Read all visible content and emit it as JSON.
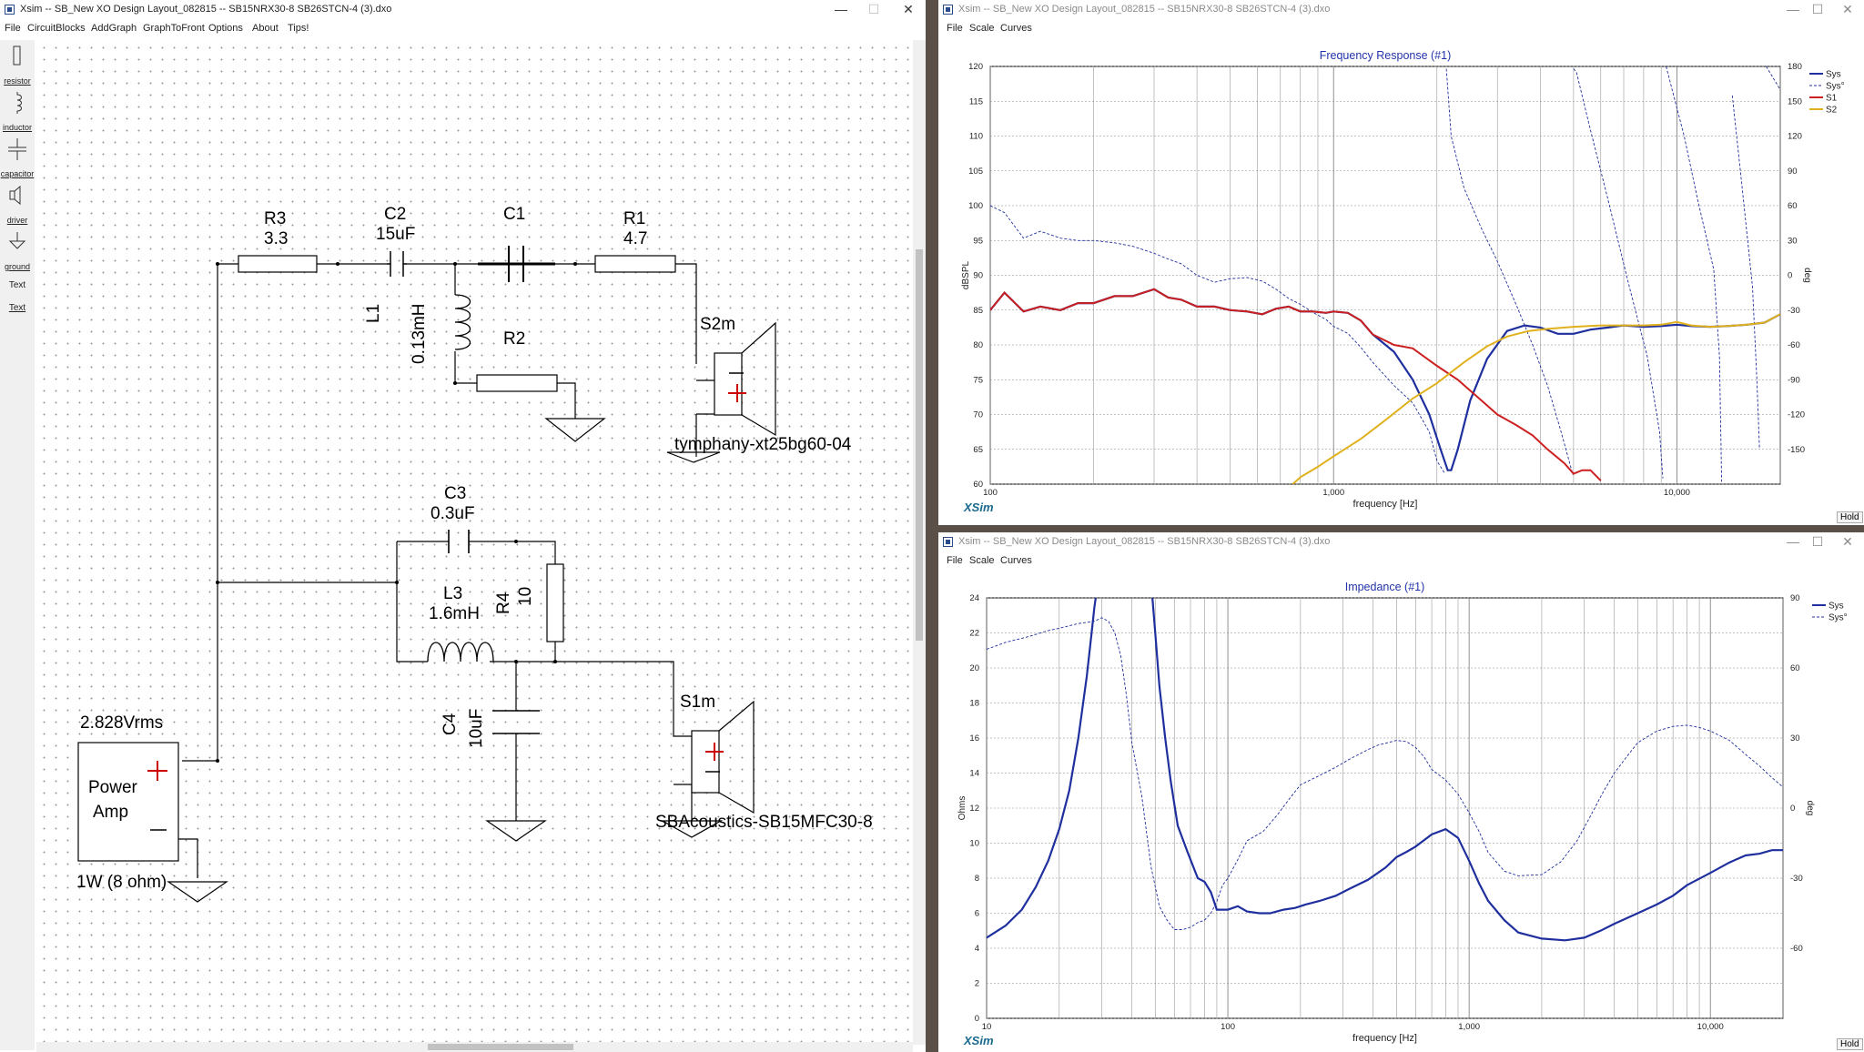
{
  "schematic_window": {
    "title": "Xsim -- SB_New XO Design Layout_082815 -- SB15NRX30-8 SB26STCN-4 (3).dxo",
    "controls": {
      "minimize": "—",
      "maximize": "☐",
      "close": "✕"
    },
    "menu": [
      "File",
      "CircuitBlocks",
      "AddGraph",
      "GraphToFront",
      "Options",
      "About",
      "Tips!"
    ],
    "tools": [
      {
        "label": "resistor",
        "icon": "resistor-icon"
      },
      {
        "label": "inductor",
        "icon": "inductor-icon"
      },
      {
        "label": "capacitor",
        "icon": "capacitor-icon"
      },
      {
        "label": "driver",
        "icon": "driver-icon"
      },
      {
        "label": "ground",
        "icon": "ground-icon"
      },
      {
        "label": "Text",
        "icon": ""
      },
      {
        "label": "Text",
        "icon": ""
      }
    ],
    "components": {
      "R3": {
        "name": "R3",
        "value": "3.3"
      },
      "C2": {
        "name": "C2",
        "value": "15uF"
      },
      "C1": {
        "name": "C1"
      },
      "R1": {
        "name": "R1",
        "value": "4.7"
      },
      "L1": {
        "name": "L1",
        "value": "0.13mH"
      },
      "R2": {
        "name": "R2"
      },
      "S2m": {
        "name": "S2m",
        "model": "tymphany-xt25bg60-04"
      },
      "C3": {
        "name": "C3",
        "value": "0.3uF"
      },
      "L3": {
        "name": "L3",
        "value": "1.6mH"
      },
      "R4": {
        "name": "R4",
        "value": "10"
      },
      "C4": {
        "name": "C4",
        "value": "10uF"
      },
      "S1m": {
        "name": "S1m",
        "model": "SBAcoustics-SB15MFC30-8"
      },
      "amp": {
        "voltage": "2.828Vrms",
        "label1": "Power",
        "label2": "Amp",
        "power": "1W (8 ohm)"
      }
    }
  },
  "fr_window": {
    "title": "Xsim -- SB_New XO Design Layout_082815 -- SB15NRX30-8 SB26STCN-4 (3).dxo",
    "menu": [
      "File",
      "Scale",
      "Curves"
    ],
    "logo": "XSim",
    "hold": "Hold",
    "colors": {
      "sys": "#1f2f9e",
      "s1": "#cc1f1f",
      "s2": "#e0b11c"
    },
    "chart_data": {
      "type": "line",
      "title": "Frequency Response (#1)",
      "xlabel": "frequency [Hz]",
      "ylabel": "dBSPL",
      "y2label": "deg",
      "xscale": "log",
      "xlim": [
        100,
        20000
      ],
      "ylim": [
        60,
        120
      ],
      "y2lim": [
        -180,
        180
      ],
      "x_tick_labels": [
        "100",
        "1,000",
        "10,000"
      ],
      "y_ticks": [
        60,
        65,
        70,
        75,
        80,
        85,
        90,
        95,
        100,
        105,
        110,
        115,
        120
      ],
      "y2_ticks": [
        -150,
        -120,
        -90,
        -60,
        -30,
        0,
        30,
        60,
        90,
        120,
        150,
        180
      ],
      "legend": [
        "Sys",
        "Sys°",
        "S1",
        "S2"
      ],
      "legend_position": "top-right",
      "series": [
        {
          "name": "Sys",
          "axis": "left",
          "x": [
            100,
            110,
            125,
            140,
            160,
            180,
            200,
            230,
            260,
            300,
            330,
            360,
            400,
            450,
            500,
            560,
            620,
            680,
            740,
            800,
            870,
            950,
            1000,
            1100,
            1200,
            1300,
            1500,
            1700,
            1900,
            2050,
            2150,
            2200,
            2300,
            2500,
            2800,
            3200,
            3600,
            4000,
            4500,
            5000,
            5600,
            6300,
            7000,
            8000,
            9000,
            10000,
            11000,
            12500,
            14000,
            16000,
            18000,
            20000
          ],
          "y": [
            85,
            87.5,
            84.8,
            85.5,
            85,
            86,
            86,
            87,
            87,
            88,
            86.8,
            86.5,
            85.5,
            85.5,
            85,
            84.8,
            84.4,
            85.2,
            85.5,
            84.8,
            84.8,
            84.6,
            84.8,
            84.6,
            83.5,
            81.5,
            79,
            75,
            70,
            65,
            62,
            62,
            65,
            72,
            78,
            82,
            82.8,
            82.5,
            81.6,
            81.6,
            82.2,
            82.5,
            82.8,
            82.6,
            82.7,
            82.9,
            82.7,
            82.6,
            82.7,
            82.9,
            83.2,
            84.4
          ]
        },
        {
          "name": "Sys°",
          "axis": "right",
          "x": [
            100,
            110,
            125,
            140,
            160,
            180,
            200,
            230,
            260,
            300,
            330,
            360,
            400,
            450,
            500,
            560,
            620,
            680,
            740,
            800,
            870,
            950,
            1000,
            1100,
            1200,
            1300,
            1500,
            1700,
            1900,
            2000,
            2100,
            2130,
            2200,
            2400,
            2700,
            3000,
            3400,
            3800,
            4200,
            4600,
            4980,
            5000,
            5100,
            5600,
            6300,
            7200,
            8200,
            8900,
            9100,
            9300,
            10500,
            11500,
            12800,
            13300,
            13500,
            14500,
            15500,
            16600,
            17100,
            17400,
            18200,
            20000
          ],
          "y": [
            60,
            54,
            32,
            38,
            32,
            30,
            30,
            28,
            25,
            19,
            14,
            10,
            0,
            -6,
            -3,
            -2,
            -5,
            -12,
            -20,
            -25,
            -32,
            -38,
            -44,
            -50,
            -62,
            -75,
            -95,
            -110,
            -135,
            -160,
            -170,
            178,
            120,
            75,
            40,
            12,
            -25,
            -60,
            -95,
            -135,
            -172,
            178,
            175,
            125,
            65,
            -5,
            -70,
            -135,
            -175,
            180,
            120,
            65,
            5,
            -70,
            -178,
            155,
            75,
            -10,
            -90,
            -150,
            180,
            160
          ]
        },
        {
          "name": "S1",
          "axis": "left",
          "x": [
            100,
            110,
            125,
            140,
            160,
            180,
            200,
            230,
            260,
            300,
            330,
            360,
            400,
            450,
            500,
            560,
            620,
            680,
            740,
            800,
            870,
            950,
            1000,
            1100,
            1200,
            1300,
            1500,
            1700,
            2000,
            2300,
            2700,
            3000,
            3400,
            3800,
            4200,
            4700,
            5000,
            5300,
            5600,
            6000
          ],
          "y": [
            85,
            87.5,
            84.8,
            85.5,
            85,
            86,
            86,
            87,
            87,
            88,
            86.8,
            86.5,
            85.5,
            85.5,
            85,
            84.8,
            84.4,
            85.2,
            85.5,
            84.8,
            84.8,
            84.6,
            84.8,
            84.6,
            83.5,
            81.5,
            80,
            79.5,
            77,
            75,
            72,
            70,
            68.5,
            67,
            65,
            63,
            61.5,
            62,
            62,
            60.5
          ]
        },
        {
          "name": "S2",
          "axis": "left",
          "x": [
            760,
            800,
            900,
            1000,
            1200,
            1400,
            1700,
            2000,
            2400,
            2800,
            3200,
            3700,
            4200,
            5000,
            6000,
            7000,
            8000,
            9000,
            10000,
            11000,
            12500,
            14000,
            16000,
            18000,
            20000
          ],
          "y": [
            60,
            61,
            62.5,
            64,
            66.5,
            69,
            72.3,
            74.5,
            77.5,
            79.8,
            81.2,
            82,
            82.3,
            82.6,
            82.8,
            82.8,
            82.8,
            82.9,
            83.3,
            82.8,
            82.6,
            82.7,
            82.9,
            83.2,
            84.4
          ]
        }
      ]
    }
  },
  "imp_window": {
    "title": "Xsim -- SB_New XO Design Layout_082815 -- SB15NRX30-8 SB26STCN-4 (3).dxo",
    "menu": [
      "File",
      "Scale",
      "Curves"
    ],
    "logo": "XSim",
    "hold": "Hold",
    "chart_data": {
      "type": "line",
      "title": "Impedance (#1)",
      "xlabel": "frequency [Hz]",
      "ylabel": "Ohms",
      "y2label": "deg",
      "xscale": "log",
      "xlim": [
        10,
        20000
      ],
      "ylim": [
        0,
        24
      ],
      "y2lim": [
        -90,
        90
      ],
      "x_tick_labels": [
        "10",
        "100",
        "1,000",
        "10,000"
      ],
      "y_ticks": [
        0,
        2,
        4,
        6,
        8,
        10,
        12,
        14,
        16,
        18,
        20,
        22,
        24
      ],
      "y2_ticks": [
        -60,
        -30,
        0,
        30,
        60,
        90
      ],
      "legend": [
        "Sys",
        "Sys°"
      ],
      "legend_position": "top-right",
      "series": [
        {
          "name": "Sys",
          "axis": "left",
          "x": [
            10,
            12,
            14,
            16,
            18,
            20,
            22,
            24,
            26,
            27,
            28,
            29,
            30,
            31,
            33,
            45,
            48,
            50,
            52,
            55,
            58,
            62,
            68,
            75,
            80,
            85,
            90,
            100,
            110,
            120,
            135,
            150,
            170,
            190,
            210,
            240,
            280,
            320,
            380,
            450,
            500,
            550,
            600,
            700,
            800,
            900,
            1000,
            1100,
            1200,
            1400,
            1600,
            2000,
            2500,
            3000,
            3500,
            4000,
            5000,
            6000,
            7000,
            8000,
            10000,
            12000,
            14000,
            16000,
            18000,
            20000
          ],
          "y": [
            4.6,
            5.3,
            6.2,
            7.5,
            9,
            10.8,
            13,
            16,
            19.5,
            21.5,
            23.5,
            25,
            26,
            27,
            28,
            28,
            25,
            22,
            19,
            16,
            13.5,
            11,
            9.5,
            8,
            7.8,
            7.2,
            6.2,
            6.2,
            6.4,
            6.1,
            6,
            6,
            6.2,
            6.3,
            6.5,
            6.7,
            7,
            7.4,
            7.9,
            8.6,
            9.2,
            9.5,
            9.8,
            10.5,
            10.8,
            10.3,
            9,
            7.7,
            6.7,
            5.6,
            4.9,
            4.55,
            4.45,
            4.6,
            5,
            5.4,
            6,
            6.5,
            7,
            7.6,
            8.3,
            8.9,
            9.3,
            9.4,
            9.6,
            9.6
          ]
        },
        {
          "name": "Sys°",
          "axis": "right",
          "x": [
            10,
            12,
            15,
            18,
            20,
            24,
            28,
            30,
            32,
            34,
            36,
            38,
            40,
            44,
            48,
            52,
            56,
            60,
            65,
            70,
            75,
            80,
            85,
            90,
            95,
            100,
            110,
            120,
            140,
            160,
            180,
            200,
            240,
            280,
            320,
            380,
            420,
            460,
            500,
            550,
            600,
            650,
            700,
            800,
            900,
            1000,
            1100,
            1200,
            1400,
            1600,
            2000,
            2400,
            2800,
            3200,
            3600,
            4000,
            4500,
            5000,
            6000,
            7000,
            8000,
            9000,
            10000,
            12000,
            14000,
            16000,
            18000,
            20000
          ],
          "y": [
            68,
            71,
            73.5,
            76,
            77,
            79,
            80,
            81.5,
            80,
            75,
            65,
            48,
            28,
            5,
            -25,
            -42,
            -48,
            -52,
            -52,
            -51,
            -49,
            -48,
            -45,
            -40,
            -33,
            -30,
            -22,
            -14,
            -10,
            -3,
            4,
            10,
            14,
            17.5,
            21,
            25,
            27,
            28,
            29,
            28.5,
            26,
            22,
            16.5,
            12,
            6,
            -2,
            -10,
            -19,
            -27,
            -29,
            -28.5,
            -23,
            -14,
            -3,
            7,
            15,
            22,
            28,
            33,
            35,
            35.5,
            34.5,
            33,
            29,
            23,
            18,
            13,
            9
          ]
        }
      ]
    }
  }
}
